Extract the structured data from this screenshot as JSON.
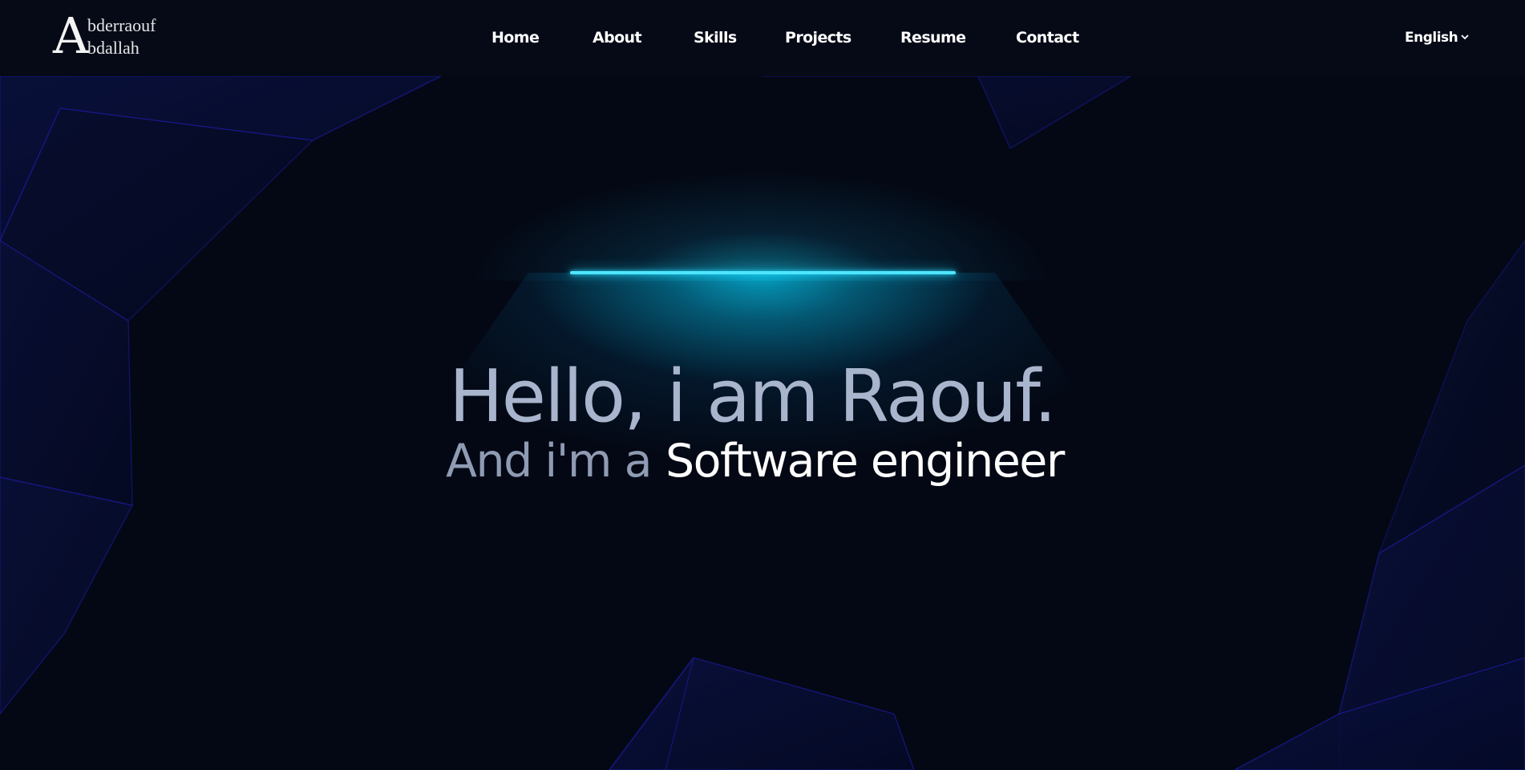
{
  "logo": {
    "initial": "A",
    "line1": "bderraouf",
    "line2": "bdallah"
  },
  "nav": {
    "items": [
      "Home",
      "About",
      "Skills",
      "Projects",
      "Resume",
      "Contact"
    ]
  },
  "language": {
    "selected": "English",
    "icon": "chevron-down-icon"
  },
  "hero": {
    "greeting": "Hello, i am Raouf.",
    "role_prefix": "And i'm a",
    "role": "Software engineer"
  },
  "colors": {
    "background": "#040814",
    "accent": "#22d3f5",
    "polygon": "#1a1a8a",
    "greeting_text": "#a9b5cd",
    "role_text": "#ffffff"
  }
}
